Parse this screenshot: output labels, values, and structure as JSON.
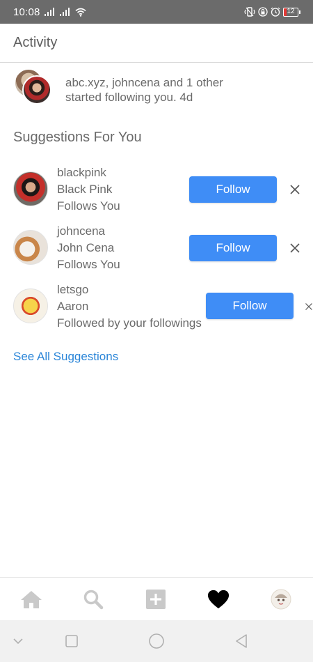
{
  "status_bar": {
    "time": "10:08",
    "signal1": ".ıl",
    "signal2": ".ıl",
    "battery_level": "12"
  },
  "header": {
    "title": "Activity"
  },
  "activity": {
    "line1": "abc.xyz, johncena  and 1 other",
    "line2": "started following you. 4d"
  },
  "suggestions": {
    "title": "Suggestions For You",
    "items": [
      {
        "username": "blackpink",
        "name": "Black Pink",
        "reason": "Follows You",
        "button": "Follow"
      },
      {
        "username": "johncena",
        "name": "John Cena",
        "reason": "Follows You",
        "button": "Follow"
      },
      {
        "username": "letsgo",
        "name": "Aaron",
        "reason": "Followed by your followings",
        "button": "Follow"
      }
    ],
    "see_all": "See All Suggestions"
  },
  "bottom_nav": {
    "items": [
      "home-icon",
      "search-icon",
      "add-icon",
      "heart-icon",
      "profile-icon"
    ],
    "active": "heart-icon"
  },
  "colors": {
    "accent": "#3f8df6",
    "link": "#2a85d8",
    "status_bar": "#6b6b6b",
    "battery_low": "#e53935"
  }
}
